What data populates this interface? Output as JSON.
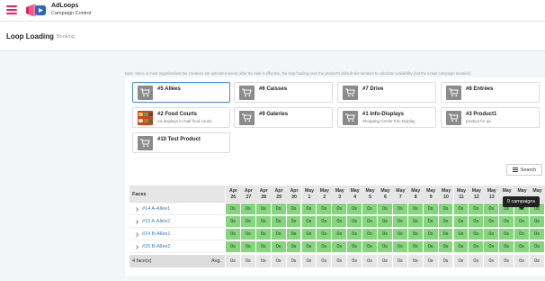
{
  "app": {
    "name": "AdLoops",
    "subtitle": "Campaign Control",
    "brand_color": "#e0245e",
    "logo_accent": "#2a64c8"
  },
  "header": {
    "title": "Loop Loading",
    "breadcrumb": "Booking"
  },
  "note": "Note: Since in most organisations the creatives are uploaded weeks after the sale is effective, the loop loading uses the product's default slot duration to calculate availability (not the actual campaign duration).",
  "products": [
    {
      "name": "#5 Allées",
      "desc": "",
      "icon": "cart-icon",
      "selected": true
    },
    {
      "name": "#6 Caisses",
      "desc": "",
      "icon": "cart-icon",
      "selected": false
    },
    {
      "name": "#7 Drive",
      "desc": "",
      "icon": "cart-icon",
      "selected": false
    },
    {
      "name": "#8 Entrées",
      "desc": "",
      "icon": "cart-icon",
      "selected": false
    },
    {
      "name": "#2 Food Courts",
      "desc": "Ad displays in mall food courts",
      "icon": "food-court-image",
      "selected": false
    },
    {
      "name": "#9 Galeries",
      "desc": "",
      "icon": "cart-icon",
      "selected": false
    },
    {
      "name": "#1 Info-Displays",
      "desc": "Shopping Center Info Display",
      "icon": "cart-icon",
      "selected": false
    },
    {
      "name": "#3 Product1",
      "desc": "product for qa",
      "icon": "cart-icon",
      "selected": false
    },
    {
      "name": "#10 Test Product",
      "desc": "",
      "icon": "cart-icon",
      "selected": false
    }
  ],
  "search": {
    "label": "Search",
    "icon": "filter-list-icon"
  },
  "grid": {
    "faces_header": "Faces",
    "faces": [
      "#14 A-Allée1",
      "#15 A-Allée2",
      "#24 B-Allée1",
      "#25 B-Allée2"
    ],
    "dates": [
      {
        "m": "Apr",
        "d": "26"
      },
      {
        "m": "Apr",
        "d": "27"
      },
      {
        "m": "Apr",
        "d": "28"
      },
      {
        "m": "Apr",
        "d": "29"
      },
      {
        "m": "Apr",
        "d": "30"
      },
      {
        "m": "May",
        "d": "1"
      },
      {
        "m": "May",
        "d": "2"
      },
      {
        "m": "May",
        "d": "3"
      },
      {
        "m": "May",
        "d": "4"
      },
      {
        "m": "May",
        "d": "5"
      },
      {
        "m": "May",
        "d": "6"
      },
      {
        "m": "May",
        "d": "7"
      },
      {
        "m": "May",
        "d": "8"
      },
      {
        "m": "May",
        "d": "9"
      },
      {
        "m": "May",
        "d": "10"
      },
      {
        "m": "May",
        "d": "11"
      },
      {
        "m": "May",
        "d": "12"
      },
      {
        "m": "May",
        "d": "13"
      },
      {
        "m": "May",
        "d": ""
      },
      {
        "m": "May",
        "d": ""
      },
      {
        "m": "May",
        "d": ""
      }
    ],
    "cell_value": "0s",
    "cell_color": "#86d67e",
    "footer_count": "4 face(s)",
    "footer_avg": "Avg.",
    "footer_value": "0s"
  },
  "tooltip": "0 campaigns"
}
